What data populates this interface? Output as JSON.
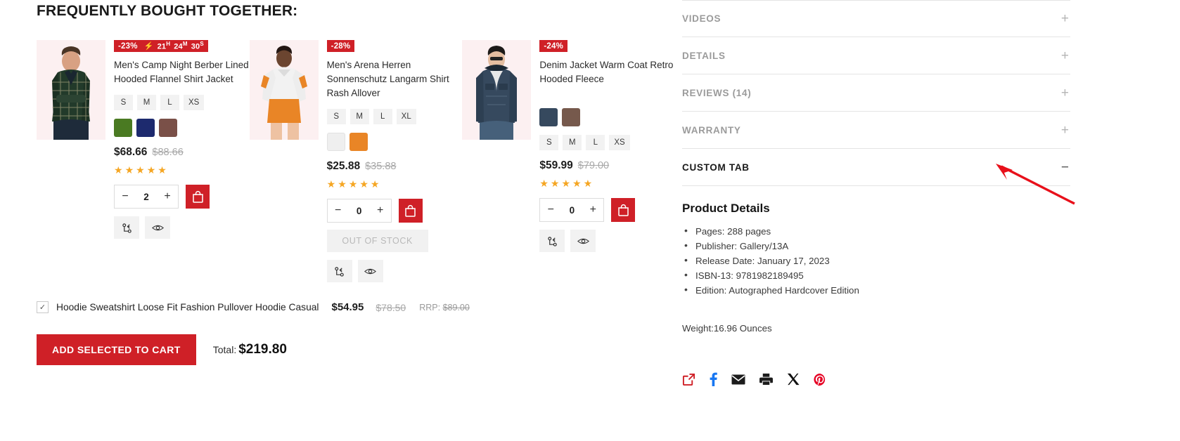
{
  "fbt": {
    "title": "FREQUENTLY BOUGHT TOGETHER:",
    "products": [
      {
        "discount": "-23%",
        "timer": {
          "bolt": "⚡",
          "hours": "21",
          "hours_unit": "H",
          "minutes": "24",
          "minutes_unit": "M",
          "seconds": "30",
          "seconds_unit": "S"
        },
        "name": "Men's Camp Night Berber Lined Hooded Flannel Shirt Jacket",
        "sizes": [
          "S",
          "M",
          "L",
          "XS"
        ],
        "colors": [
          "#4a7a22",
          "#1d2a6e",
          "#7a5048"
        ],
        "price_now": "$68.66",
        "price_old": "$88.66",
        "rating": 5,
        "qty": "2",
        "minus": "−",
        "plus": "+",
        "in_stock": true,
        "out_of_stock_label": ""
      },
      {
        "discount": "-28%",
        "timer": null,
        "name": "Men's Arena Herren Sonnenschutz Langarm Shirt Rash Allover",
        "sizes": [
          "S",
          "M",
          "L",
          "XL"
        ],
        "colors": [
          "#efefef",
          "#e98526"
        ],
        "price_now": "$25.88",
        "price_old": "$35.88",
        "rating": 5,
        "qty": "0",
        "minus": "−",
        "plus": "+",
        "in_stock": false,
        "out_of_stock_label": "OUT OF STOCK"
      },
      {
        "discount": "-24%",
        "timer": null,
        "name": "Denim Jacket Warm Coat Retro Hooded Fleece",
        "sizes": [
          "S",
          "M",
          "L",
          "XS"
        ],
        "colors": [
          "#36495e",
          "#76594c"
        ],
        "price_now": "$59.99",
        "price_old": "$79.00",
        "rating": 5,
        "qty": "0",
        "minus": "−",
        "plus": "+",
        "in_stock": true,
        "out_of_stock_label": ""
      }
    ],
    "bundle_item": {
      "checked_mark": "✓",
      "name": "Hoodie Sweatshirt Loose Fit Fashion Pullover Hoodie Casual",
      "price_now": "$54.95",
      "price_old": "$78.50",
      "rrp_label": "RRP:",
      "rrp_value": "$89.00"
    },
    "add_all_label": "ADD SELECTED TO CART",
    "total_label": "Total:",
    "total_value": "$219.80"
  },
  "panel": {
    "accordion": [
      {
        "label": "VIDEOS",
        "sign": "+",
        "active": false
      },
      {
        "label": "DETAILS",
        "sign": "+",
        "active": false
      },
      {
        "label": "REVIEWS (14)",
        "sign": "+",
        "active": false
      },
      {
        "label": "WARRANTY",
        "sign": "+",
        "active": false
      },
      {
        "label": "CUSTOM TAB",
        "sign": "−",
        "active": true
      }
    ],
    "details": {
      "heading": "Product Details",
      "items": [
        "Pages: 288 pages",
        "Publisher: Gallery/13A",
        "Release Date: January 17, 2023",
        "ISBN-13: 9781982189495",
        "Edition: Autographed Hardcover Edition"
      ],
      "weight": "Weight:16.96 Ounces"
    },
    "share_icons": [
      "share-external-icon",
      "facebook-icon",
      "email-icon",
      "print-icon",
      "x-twitter-icon",
      "pinterest-icon"
    ]
  },
  "colors": {
    "brand_red": "#cf2027",
    "star_gold": "#f5a623",
    "facebook_blue": "#1877f2",
    "pinterest_red": "#e60023",
    "annotation_red": "#e8101a"
  }
}
